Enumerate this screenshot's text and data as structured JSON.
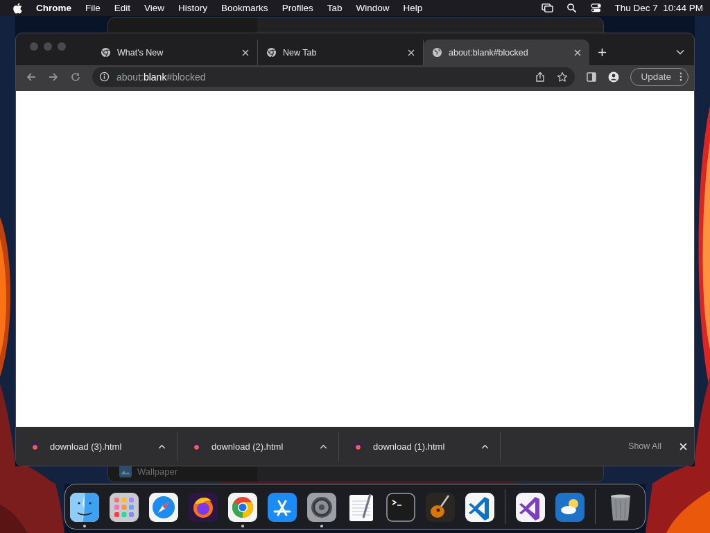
{
  "menu_bar": {
    "app_name": "Chrome",
    "menus": [
      "File",
      "Edit",
      "View",
      "History",
      "Bookmarks",
      "Profiles",
      "Tab",
      "Window",
      "Help"
    ],
    "clock": "Thu Dec 7  10:44 PM"
  },
  "background_window": {
    "sidebar_item": "Wallpaper"
  },
  "browser": {
    "tabs": [
      {
        "title": "What's New",
        "kind": "chrome",
        "selected": false
      },
      {
        "title": "New Tab",
        "kind": "chrome",
        "selected": false
      },
      {
        "title": "about:blank#blocked",
        "kind": "page",
        "selected": true
      }
    ],
    "address": "about:**blank**#blocked",
    "update_button": "Update",
    "downloads": [
      "download (3).html",
      "download (2).html",
      "download (1).html"
    ],
    "show_all": "Show All"
  },
  "dock": {
    "apps": [
      {
        "kind": "finder",
        "running": true
      },
      {
        "kind": "launchpad",
        "running": false
      },
      {
        "kind": "safari",
        "running": false
      },
      {
        "kind": "firefox",
        "running": false
      },
      {
        "kind": "chrome",
        "running": true
      },
      {
        "kind": "appstore",
        "running": false
      },
      {
        "kind": "settings",
        "running": true
      },
      {
        "kind": "textedit",
        "running": false
      },
      {
        "kind": "terminal",
        "running": false
      },
      {
        "kind": "guitar",
        "running": false
      },
      {
        "kind": "vscode",
        "running": false
      }
    ],
    "recent": [
      {
        "kind": "visualstudio",
        "running": false
      },
      {
        "kind": "weather",
        "running": false
      }
    ]
  }
}
